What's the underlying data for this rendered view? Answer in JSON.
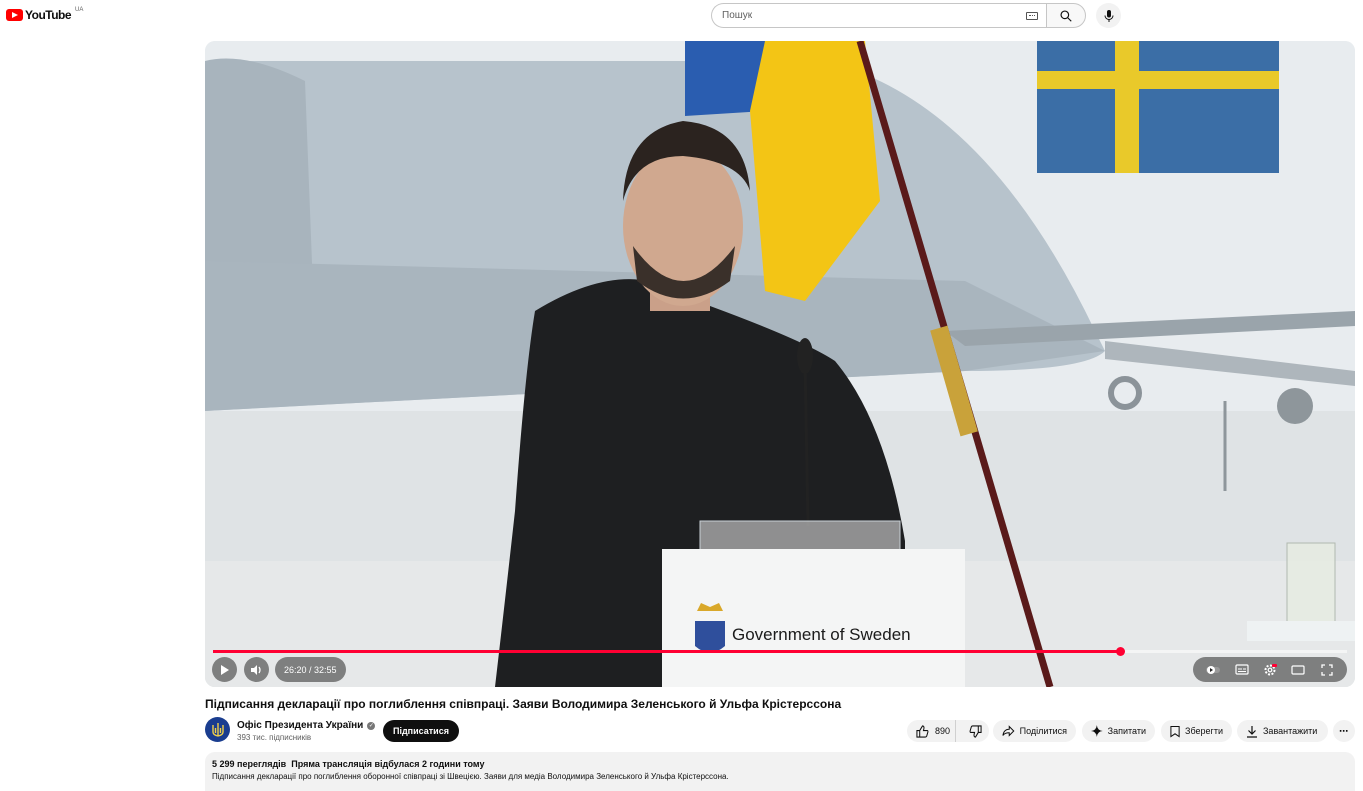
{
  "masthead": {
    "logo_text": "YouTube",
    "country_code": "UA",
    "search_placeholder": "Пошук",
    "icons": [
      "youtube-logo-icon",
      "keyboard-icon",
      "search-icon",
      "microphone-icon"
    ]
  },
  "player": {
    "time": "26:20 / 32:55",
    "progress": 0.8,
    "podium_sign": "Government of Sweden",
    "icons": [
      "play-icon",
      "volume-icon",
      "autoplay-toggle-icon",
      "subtitles-icon",
      "settings-icon",
      "theater-mode-icon",
      "fullscreen-icon"
    ]
  },
  "video": {
    "title": "Підписання декларації про поглиблення співпраці. Заяви Володимира Зеленського й Ульфа Крістерссона"
  },
  "channel": {
    "name": "Офіс Президента України",
    "subscribers": "393 тис. підписників",
    "subscribe_label": "Підписатися"
  },
  "actions": {
    "likes": "890",
    "share": "Поділитися",
    "ask": "Запитати",
    "save": "Зберегти",
    "download": "Завантажити",
    "more": "⋯"
  },
  "description": {
    "views": "5 299 переглядів",
    "stream_info": "Пряма трансляція відбулася 2 години тому",
    "text": "Підписання декларації про поглиблення оборонної співпраці зі Швецією. Заяви для медіа Володимира Зеленського й Ульфа Крістерссона."
  },
  "colors": {
    "brand_red": "#ff0000",
    "progress_red": "#ff0033",
    "chip_bg": "#f2f2f2",
    "subscribe_bg": "#0f0f0f"
  }
}
